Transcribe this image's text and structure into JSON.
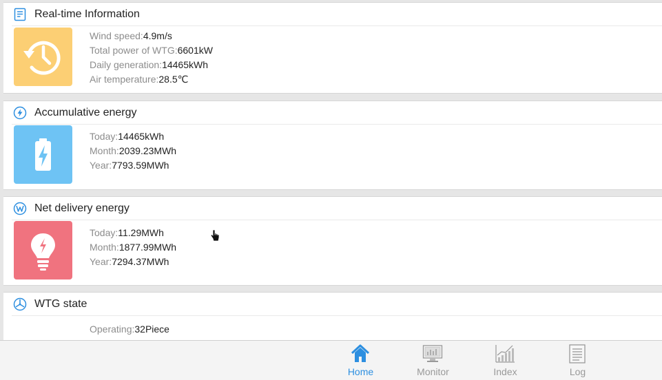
{
  "sections": {
    "realtime": {
      "title": "Real-time Information",
      "rows": [
        {
          "label": "Wind speed:",
          "value": "4.9m/s"
        },
        {
          "label": "Total power of WTG:",
          "value": "6601kW"
        },
        {
          "label": "Daily generation:",
          "value": "14465kWh"
        },
        {
          "label": "Air temperature:",
          "value": "28.5℃"
        }
      ]
    },
    "accumulative": {
      "title": "Accumulative energy",
      "rows": [
        {
          "label": "Today:",
          "value": "14465kWh"
        },
        {
          "label": "Month:",
          "value": "2039.23MWh"
        },
        {
          "label": "Year:",
          "value": "7793.59MWh"
        }
      ]
    },
    "net_delivery": {
      "title": "Net delivery energy",
      "rows": [
        {
          "label": "Today:",
          "value": "11.29MWh"
        },
        {
          "label": "Month:",
          "value": "1877.99MWh"
        },
        {
          "label": "Year:",
          "value": "7294.37MWh"
        }
      ]
    },
    "wtg_state": {
      "title": "WTG state",
      "rows": [
        {
          "label": "Operating:",
          "value": "32Piece"
        }
      ]
    }
  },
  "tabs": [
    {
      "label": "Home",
      "icon": "home-icon",
      "active": true
    },
    {
      "label": "Monitor",
      "icon": "monitor-icon",
      "active": false
    },
    {
      "label": "Index",
      "icon": "chart-icon",
      "active": false
    },
    {
      "label": "Log",
      "icon": "document-icon",
      "active": false
    }
  ],
  "colors": {
    "accent": "#2d8fe0",
    "realtime_tile": "#fccf74",
    "accumulative_tile": "#6ec3f4",
    "net_delivery_tile": "#f0737f"
  }
}
